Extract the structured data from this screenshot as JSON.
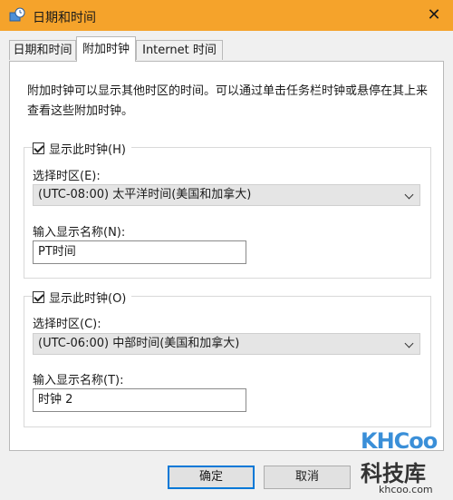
{
  "window": {
    "title": "日期和时间",
    "close_glyph": "✕"
  },
  "tabs": [
    {
      "label": "日期和时间",
      "active": false
    },
    {
      "label": "附加时钟",
      "active": true
    },
    {
      "label": "Internet 时间",
      "active": false
    }
  ],
  "description": "附加时钟可以显示其他时区的时间。可以通过单击任务栏时钟或悬停在其上来查看这些附加时钟。",
  "clock1": {
    "checkbox_label": "显示此时钟(H)",
    "checked": true,
    "timezone_label": "选择时区(E):",
    "timezone_value": "(UTC-08:00) 太平洋时间(美国和加拿大)",
    "name_label": "输入显示名称(N):",
    "name_value": "PT时间"
  },
  "clock2": {
    "checkbox_label": "显示此时钟(O)",
    "checked": true,
    "timezone_label": "选择时区(C):",
    "timezone_value": "(UTC-06:00) 中部时间(美国和加拿大)",
    "name_label": "输入显示名称(T):",
    "name_value": "时钟 2"
  },
  "buttons": {
    "ok": "确定",
    "cancel": "取消"
  },
  "watermark": {
    "logo_text": "KHCoo",
    "cn_text": "科技库",
    "url": "khcoo.com"
  },
  "colors": {
    "titlebar": "#f5a32b",
    "default_button_border": "#0078d7",
    "watermark_blue": "#3a8fd8"
  },
  "icons": {
    "app": "clock-app-icon",
    "close": "close-icon",
    "dropdown": "chevron-down-icon",
    "checkbox": "checkmark-icon"
  }
}
